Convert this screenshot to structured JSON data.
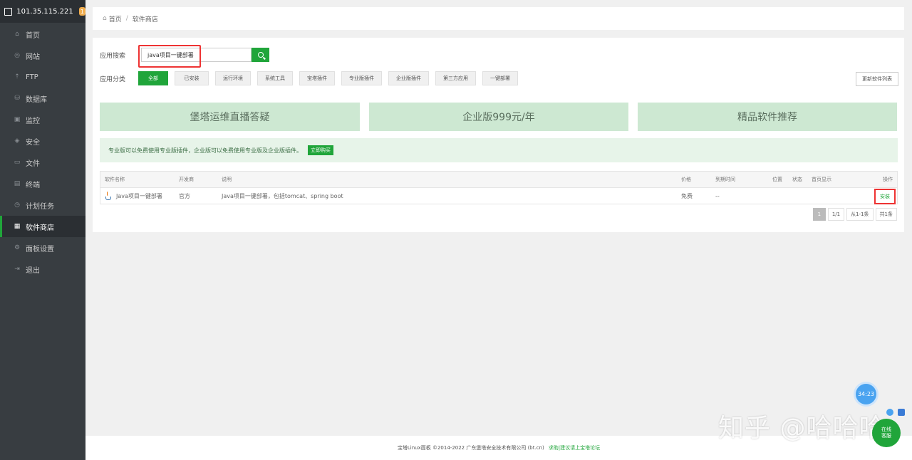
{
  "server": {
    "ip": "101.35.115.221",
    "badge": "1"
  },
  "sidebar": {
    "items": [
      {
        "label": "首页",
        "icon": "home-icon",
        "glyph": "⌂"
      },
      {
        "label": "网站",
        "icon": "globe-icon",
        "glyph": "◎"
      },
      {
        "label": "FTP",
        "icon": "ftp-icon",
        "glyph": "⇡"
      },
      {
        "label": "数据库",
        "icon": "database-icon",
        "glyph": "⛁"
      },
      {
        "label": "监控",
        "icon": "monitor-icon",
        "glyph": "▣"
      },
      {
        "label": "安全",
        "icon": "shield-icon",
        "glyph": "◈"
      },
      {
        "label": "文件",
        "icon": "folder-icon",
        "glyph": "▭"
      },
      {
        "label": "终端",
        "icon": "terminal-icon",
        "glyph": "▤"
      },
      {
        "label": "计划任务",
        "icon": "clock-icon",
        "glyph": "◷"
      },
      {
        "label": "软件商店",
        "icon": "apps-icon",
        "glyph": "▦",
        "active": true
      },
      {
        "label": "面板设置",
        "icon": "gear-icon",
        "glyph": "⚙"
      },
      {
        "label": "退出",
        "icon": "logout-icon",
        "glyph": "⇥"
      }
    ]
  },
  "breadcrumb": {
    "home": "首页",
    "sep": "/",
    "current": "软件商店"
  },
  "search": {
    "label": "应用搜索",
    "value": "java项目一键部署"
  },
  "categories": {
    "label": "应用分类",
    "items": [
      "全部",
      "已安装",
      "运行环境",
      "系统工具",
      "宝塔插件",
      "专业版插件",
      "企业版插件",
      "第三方应用",
      "一键部署"
    ],
    "active_index": 0,
    "update_button": "更新软件列表"
  },
  "banners": [
    "堡塔运维直播答疑",
    "企业版999元/年",
    "精品软件推荐"
  ],
  "notice": {
    "text": "专业版可以免费使用专业版插件，企业版可以免费使用专业版及企业版插件。",
    "button": "立即购买"
  },
  "table": {
    "headers": {
      "name": "软件名称",
      "dev": "开发商",
      "desc": "说明",
      "price": "价格",
      "expire": "到期时间",
      "pos": "位置",
      "status": "状态",
      "home": "首页显示",
      "op": "操作"
    },
    "rows": [
      {
        "name": "Java项目一键部署",
        "dev": "官方",
        "desc": "Java项目一键部署，包括tomcat、spring boot",
        "price": "免费",
        "expire": "--",
        "action": "安装"
      }
    ]
  },
  "pager": {
    "current": "1",
    "pages": "1/1",
    "range": "从1-1条",
    "total": "共1条"
  },
  "footer": {
    "text": "宝塔Linux面板 ©2014-2022 广东堡塔安全技术有限公司 (bt.cn)",
    "link": "求助|建议请上宝塔论坛"
  },
  "widgets": {
    "timer": "34:23",
    "watermark": "知乎 @哈哈哈",
    "support": "在线\n客服"
  },
  "colors": {
    "accent": "#20a53a",
    "sidebar": "#383d41",
    "highlight": "#ee3333"
  }
}
